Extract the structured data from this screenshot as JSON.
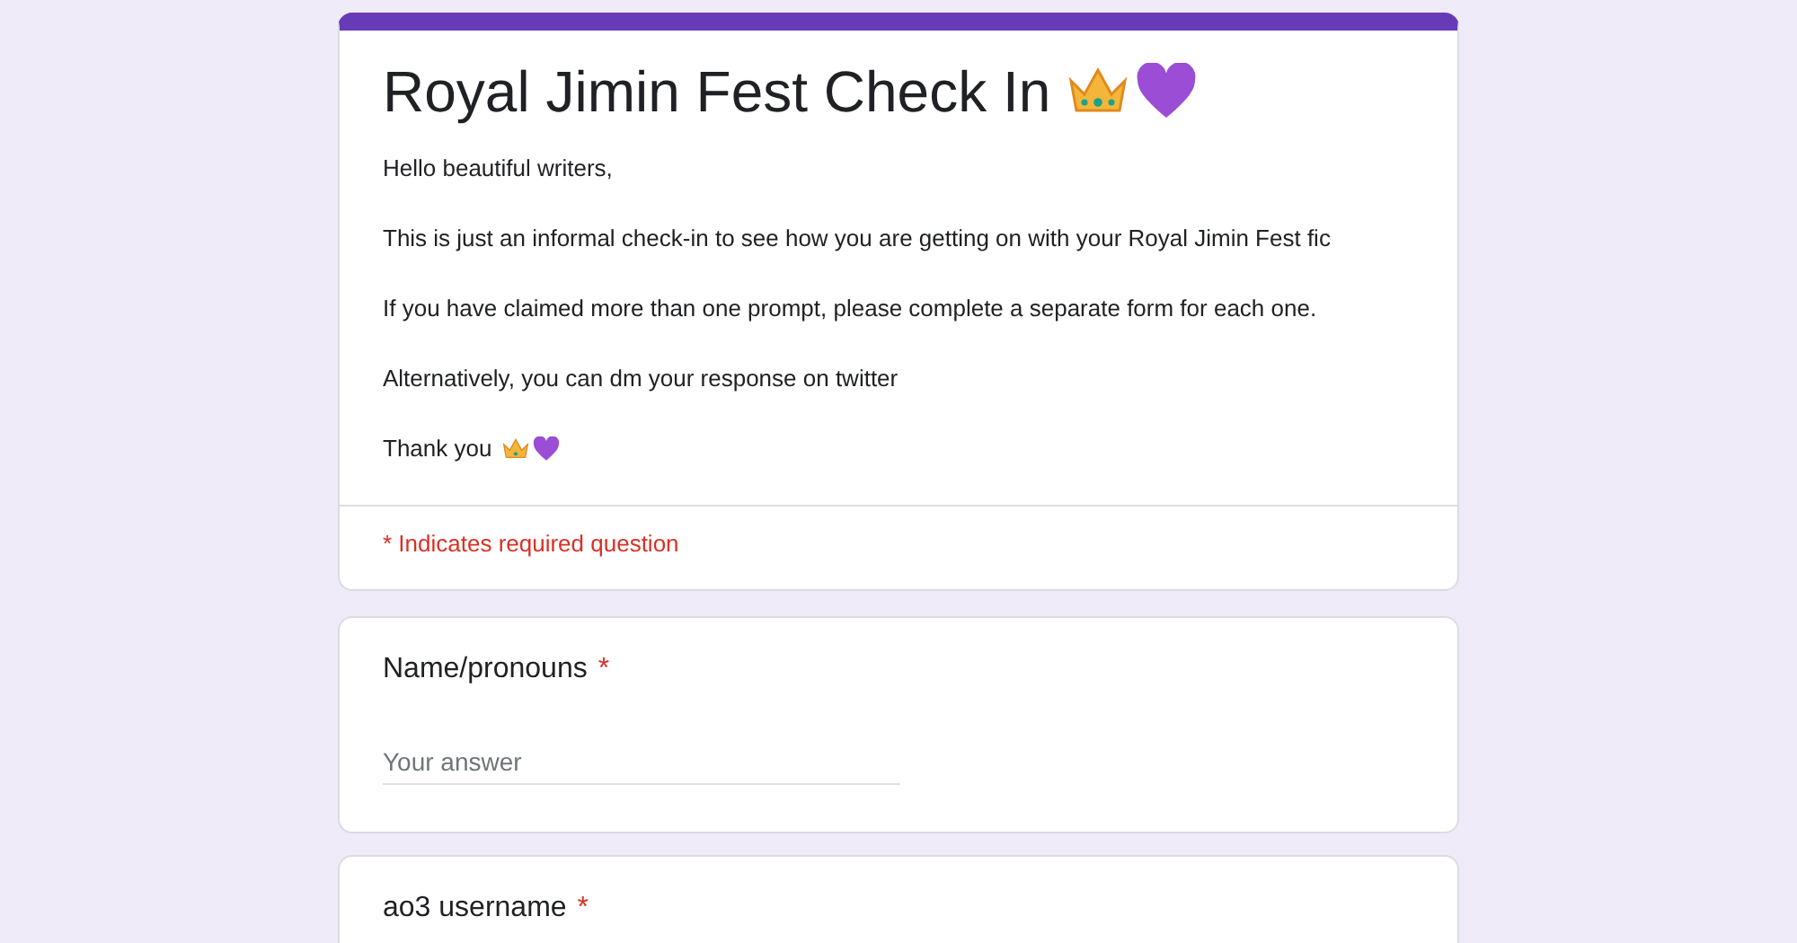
{
  "form": {
    "title": "Royal Jimin Fest Check In",
    "description": [
      "Hello beautiful writers,",
      "This is just an informal check-in to see how you are getting on with your Royal Jimin Fest fic",
      "If you have claimed more than one prompt, please complete a separate form for each one.",
      "Alternatively, you can dm your response on twitter",
      "Thank you"
    ],
    "required_note": "* Indicates required question"
  },
  "questions": [
    {
      "label": "Name/pronouns",
      "required_mark": "*",
      "placeholder": "Your answer"
    },
    {
      "label": "ao3 username",
      "required_mark": "*"
    }
  ]
}
